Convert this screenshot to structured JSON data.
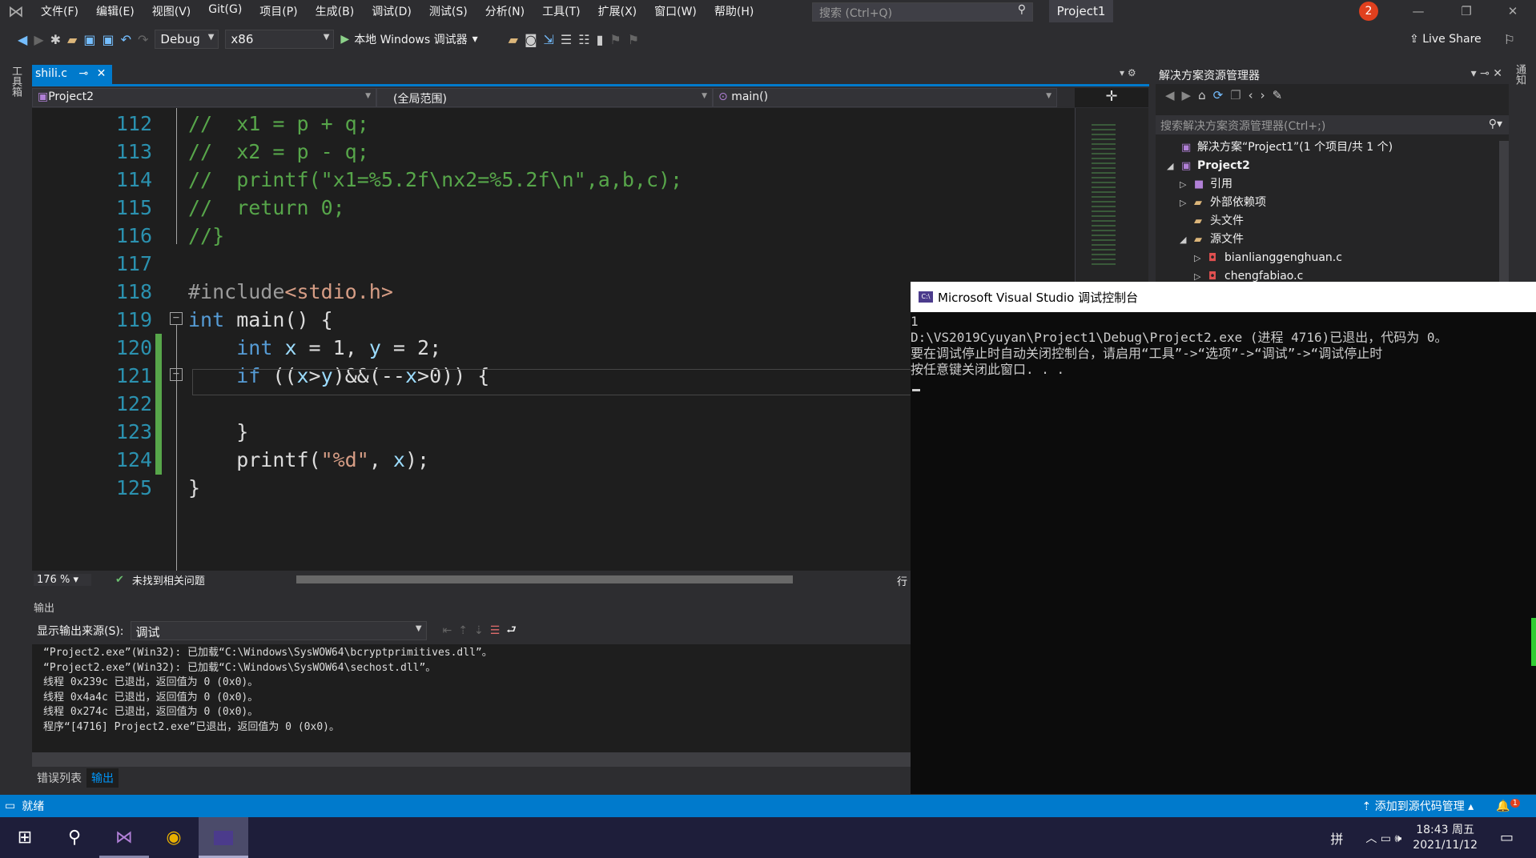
{
  "menubar": {
    "items": [
      "文件(F)",
      "编辑(E)",
      "视图(V)",
      "Git(G)",
      "项目(P)",
      "生成(B)",
      "调试(D)",
      "测试(S)",
      "分析(N)",
      "工具(T)",
      "扩展(X)",
      "窗口(W)",
      "帮助(H)"
    ],
    "search_placeholder": "搜索 (Ctrl+Q)",
    "project_title": "Project1",
    "notification_count": "2"
  },
  "toolbar": {
    "config": "Debug",
    "platform": "x86",
    "run_label": "本地 Windows 调试器",
    "live_share": "Live Share"
  },
  "side_strip": {
    "label": "工具箱"
  },
  "right_strip": {
    "label": "通知"
  },
  "editor": {
    "tab": "shili.c",
    "nav_project": "Project2",
    "nav_scope": "(全局范围)",
    "nav_member": "main()",
    "lines": [
      {
        "n": "112",
        "tokens": [
          [
            "//  x1 = p + q;",
            "comment"
          ]
        ]
      },
      {
        "n": "113",
        "tokens": [
          [
            "//  x2 = p - q;",
            "comment"
          ]
        ]
      },
      {
        "n": "114",
        "tokens": [
          [
            "//  printf(\"x1=%5.2f\\nx2=%5.2f\\n\",a,b,c);",
            "comment"
          ]
        ]
      },
      {
        "n": "115",
        "tokens": [
          [
            "//  return 0;",
            "comment"
          ]
        ]
      },
      {
        "n": "116",
        "tokens": [
          [
            "//}",
            "comment"
          ]
        ]
      },
      {
        "n": "117",
        "tokens": []
      },
      {
        "n": "118",
        "tokens": [
          [
            "#include",
            "pre"
          ],
          [
            "<stdio.h>",
            "string"
          ]
        ]
      },
      {
        "n": "119",
        "tokens": [
          [
            "int",
            "keyword"
          ],
          [
            " main() {",
            "plain"
          ]
        ]
      },
      {
        "n": "120",
        "tokens": [
          [
            "    ",
            "plain"
          ],
          [
            "int",
            "keyword"
          ],
          [
            " ",
            "plain"
          ],
          [
            "x",
            "var"
          ],
          [
            " = 1, ",
            "plain"
          ],
          [
            "y",
            "var"
          ],
          [
            " = 2;",
            "plain"
          ]
        ]
      },
      {
        "n": "121",
        "tokens": [
          [
            "    ",
            "plain"
          ],
          [
            "if",
            "keyword"
          ],
          [
            " ((",
            "plain"
          ],
          [
            "x",
            "var"
          ],
          [
            ">",
            "plain"
          ],
          [
            "y",
            "var"
          ],
          [
            ")&&(--",
            "plain"
          ],
          [
            "x",
            "var"
          ],
          [
            ">0)) {",
            "plain"
          ]
        ]
      },
      {
        "n": "122",
        "tokens": []
      },
      {
        "n": "123",
        "tokens": [
          [
            "    }",
            "plain"
          ]
        ]
      },
      {
        "n": "124",
        "tokens": [
          [
            "    printf(",
            "plain"
          ],
          [
            "\"%d\"",
            "string"
          ],
          [
            ", ",
            "plain"
          ],
          [
            "x",
            "var"
          ],
          [
            ");",
            "plain"
          ]
        ]
      },
      {
        "n": "125",
        "tokens": [
          [
            "}",
            "plain"
          ]
        ]
      }
    ],
    "zoom": "176 %",
    "issues": "未找到相关问题",
    "line_label": "行"
  },
  "output": {
    "title": "输出",
    "source_label": "显示输出来源(S):",
    "source_value": "调试",
    "lines": [
      "“Project2.exe”(Win32): 已加载“C:\\Windows\\SysWOW64\\bcryptprimitives.dll”。",
      "“Project2.exe”(Win32): 已加载“C:\\Windows\\SysWOW64\\sechost.dll”。",
      "线程 0x239c 已退出，返回值为 0 (0x0)。",
      "线程 0x4a4c 已退出，返回值为 0 (0x0)。",
      "线程 0x274c 已退出，返回值为 0 (0x0)。",
      "程序“[4716] Project2.exe”已退出，返回值为 0 (0x0)。"
    ],
    "tabs": [
      "错误列表",
      "输出"
    ]
  },
  "solution_explorer": {
    "title": "解决方案资源管理器",
    "search_placeholder": "搜索解决方案资源管理器(Ctrl+;)",
    "items": [
      {
        "label": "解决方案“Project1”(1 个项目/共 1 个)",
        "tri": "",
        "icon": "solution-icon",
        "glyph": "▣"
      },
      {
        "label": "Project2",
        "tri": "◢",
        "icon": "project-icon",
        "glyph": "▣"
      },
      {
        "label": "引用",
        "tri": "▷",
        "icon": "references-icon",
        "glyph": "■"
      },
      {
        "label": "外部依赖项",
        "tri": "▷",
        "icon": "folder-icon",
        "glyph": "▰"
      },
      {
        "label": "头文件",
        "tri": "",
        "icon": "folder-icon",
        "glyph": "▰"
      },
      {
        "label": "源文件",
        "tri": "◢",
        "icon": "folder-icon",
        "glyph": "▰"
      },
      {
        "label": "bianlianggenghuan.c",
        "tri": "▷",
        "icon": "c-file-icon",
        "glyph": "◘"
      },
      {
        "label": "chengfabiao.c",
        "tri": "▷",
        "icon": "c-file-icon",
        "glyph": "◘"
      }
    ]
  },
  "console": {
    "title": "Microsoft Visual Studio 调试控制台",
    "lines": [
      "1",
      "D:\\VS2019Cyuyan\\Project1\\Debug\\Project2.exe (进程 4716)已退出，代码为 0。",
      "要在调试停止时自动关闭控制台，请启用“工具”->“选项”->“调试”->“调试停止时",
      "按任意键关闭此窗口. . ."
    ]
  },
  "statusbar": {
    "ready": "就绪",
    "source_control": "添加到源代码管理",
    "notif": "1"
  },
  "taskbar": {
    "time": "18:43 周五",
    "date": "2021/11/12",
    "ime": "拼"
  },
  "colors": {
    "accent": "#007acc",
    "comment": "#57a64a",
    "keyword": "#569cd6"
  }
}
